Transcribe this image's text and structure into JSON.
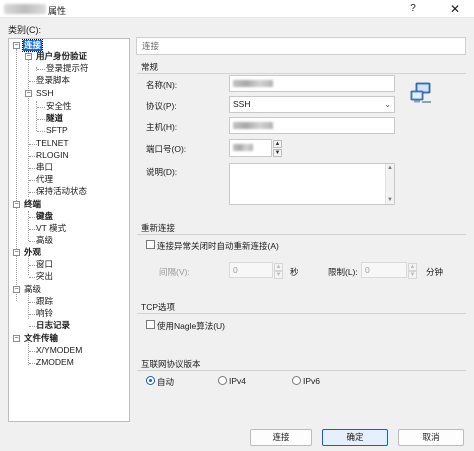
{
  "window": {
    "title_suffix": "属性",
    "help_glyph": "?",
    "close_glyph": "✕"
  },
  "category": {
    "label": "类别(C):",
    "tree": [
      {
        "label": "连接",
        "bold": true,
        "selected": true
      },
      {
        "label": "用户身份验证",
        "bold": true
      },
      {
        "label": "登录提示符"
      },
      {
        "label": "登录脚本"
      },
      {
        "label": "SSH"
      },
      {
        "label": "安全性"
      },
      {
        "label": "隧道"
      },
      {
        "label": "SFTP"
      },
      {
        "label": "TELNET"
      },
      {
        "label": "RLOGIN"
      },
      {
        "label": "串口"
      },
      {
        "label": "代理"
      },
      {
        "label": "保持活动状态"
      },
      {
        "label": "终端",
        "bold": true
      },
      {
        "label": "键盘",
        "bold": true
      },
      {
        "label": "VT 模式"
      },
      {
        "label": "高级"
      },
      {
        "label": "外观",
        "bold": true
      },
      {
        "label": "窗口"
      },
      {
        "label": "突出"
      },
      {
        "label": "高级"
      },
      {
        "label": "跟踪"
      },
      {
        "label": "响铃"
      },
      {
        "label": "日志记录",
        "bold": true
      },
      {
        "label": "文件传输",
        "bold": true
      },
      {
        "label": "X/YMODEM"
      },
      {
        "label": "ZMODEM"
      }
    ]
  },
  "breadcrumb": "连接",
  "general": {
    "group_title": "常规",
    "name_label": "名称(N):",
    "protocol_label": "协议(P):",
    "protocol_value": "SSH",
    "host_label": "主机(H):",
    "port_label": "端口号(O):",
    "description_label": "说明(D):"
  },
  "reconnect": {
    "group_title": "重新连接",
    "checkbox_label": "连接异常关闭时自动重新连接(A)",
    "interval_label": "间隔(V):",
    "interval_value": "0",
    "interval_unit": "秒",
    "limit_label": "限制(L):",
    "limit_value": "0",
    "limit_unit": "分钟"
  },
  "tcp": {
    "group_title": "TCP选项",
    "checkbox_label": "使用Nagle算法(U)"
  },
  "ip_version": {
    "group_title": "互联网协议版本",
    "options": [
      "自动",
      "IPv4",
      "IPv6"
    ],
    "selected": "自动"
  },
  "buttons": {
    "connect": "连接",
    "ok": "确定",
    "cancel": "取消"
  },
  "icons": {
    "network": "network-computers-icon",
    "spin_up": "▲",
    "spin_down": "▼",
    "dropdown": "⌄"
  },
  "colors": {
    "selection": "#0a64d8",
    "radio_accent": "#1a5fb4"
  }
}
